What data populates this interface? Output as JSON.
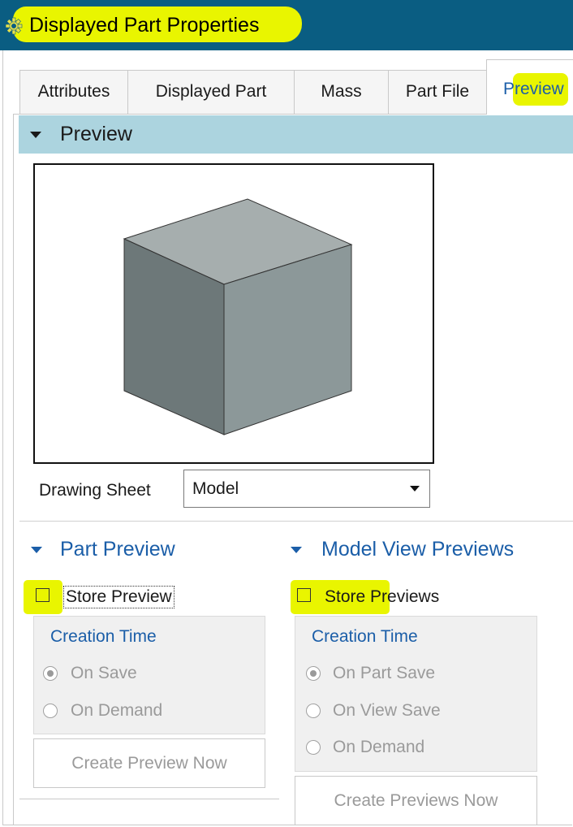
{
  "window": {
    "title": "Displayed Part Properties",
    "icon": "gear-icon"
  },
  "tabs": [
    "Attributes",
    "Displayed Part",
    "Mass",
    "Part File",
    "Preview"
  ],
  "active_tab": "Preview",
  "section": {
    "title": "Preview"
  },
  "preview": {
    "drawing_sheet_label": "Drawing Sheet",
    "drawing_sheet_value": "Model"
  },
  "part_preview": {
    "title": "Part Preview",
    "checkbox_label": "Store Preview",
    "checked": false,
    "group_title": "Creation Time",
    "options": [
      "On Save",
      "On Demand"
    ],
    "selected": "On Save",
    "button_label": "Create Preview Now"
  },
  "model_view_previews": {
    "title": "Model View Previews",
    "checkbox_label": "Store Previews",
    "checked": false,
    "group_title": "Creation Time",
    "options": [
      "On Part Save",
      "On View Save",
      "On Demand"
    ],
    "selected": "On Part Save",
    "button_label": "Create Previews Now"
  },
  "colors": {
    "titlebar": "#0a5d82",
    "section_header": "#acd4df",
    "accent": "#1b5ea8",
    "highlight": "#e9f500"
  }
}
